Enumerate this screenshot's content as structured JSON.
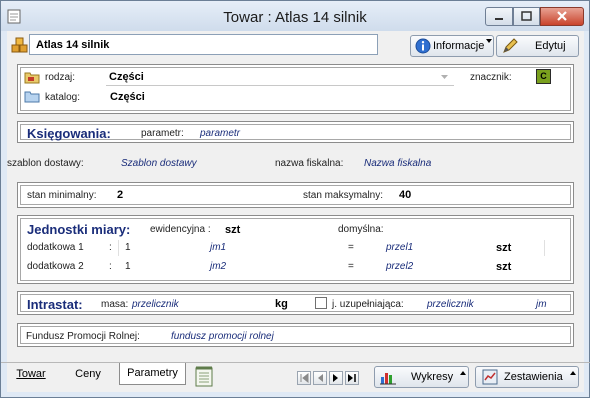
{
  "window": {
    "title": "Towar : Atlas 14 silnik"
  },
  "header": {
    "name_value": "Atlas 14 silnik",
    "info_button": "Informacje",
    "edit_button": "Edytuj"
  },
  "general": {
    "type_label": "rodzaj:",
    "type_value": "Części",
    "catalog_label": "katalog:",
    "catalog_value": "Części",
    "marker_label": "znacznik:",
    "marker_value": "C",
    "marker_color": "#7aa01e"
  },
  "accounting": {
    "title": "Księgowania:",
    "param_label": "parametr:",
    "param_value": "parametr",
    "template_label": "szablon dostawy:",
    "template_value": "Szablon dostawy",
    "fiscal_label": "nazwa fiskalna:",
    "fiscal_value": "Nazwa fiskalna"
  },
  "stock": {
    "min_label": "stan minimalny:",
    "min_value": "2",
    "max_label": "stan maksymalny:",
    "max_value": "40"
  },
  "units": {
    "title": "Jednostki miary:",
    "evid_label": "ewidencyjna :",
    "evid_value": "szt",
    "default_label": "domyślna:",
    "rows": [
      {
        "label": "dodatkowa 1",
        "colon": ":",
        "qty": "1",
        "unit": "jm1",
        "eq": "=",
        "conv": "przel1",
        "base": "szt"
      },
      {
        "label": "dodatkowa 2",
        "colon": ":",
        "qty": "1",
        "unit": "jm2",
        "eq": "=",
        "conv": "przel2",
        "base": "szt"
      }
    ]
  },
  "intrastat": {
    "title": "Intrastat:",
    "mass_label": "masa:",
    "mass_value": "przelicznik",
    "mass_unit": "kg",
    "supp_label": "j. uzupełniająca:",
    "supp_value": "przelicznik",
    "supp_unit": "jm",
    "supp_checked": false
  },
  "fund": {
    "label": "Fundusz Promocji Rolnej:",
    "value": "fundusz promocji rolnej"
  },
  "tabs": [
    {
      "label": "Towar",
      "active": false
    },
    {
      "label": "Ceny",
      "active": false
    },
    {
      "label": "Parametry",
      "active": true
    }
  ],
  "bottom": {
    "charts_button": "Wykresy",
    "reports_button": "Zestawienia"
  },
  "colors": {
    "accent_text": "#1a2d7a",
    "window_frame": "#dfe9f5"
  }
}
